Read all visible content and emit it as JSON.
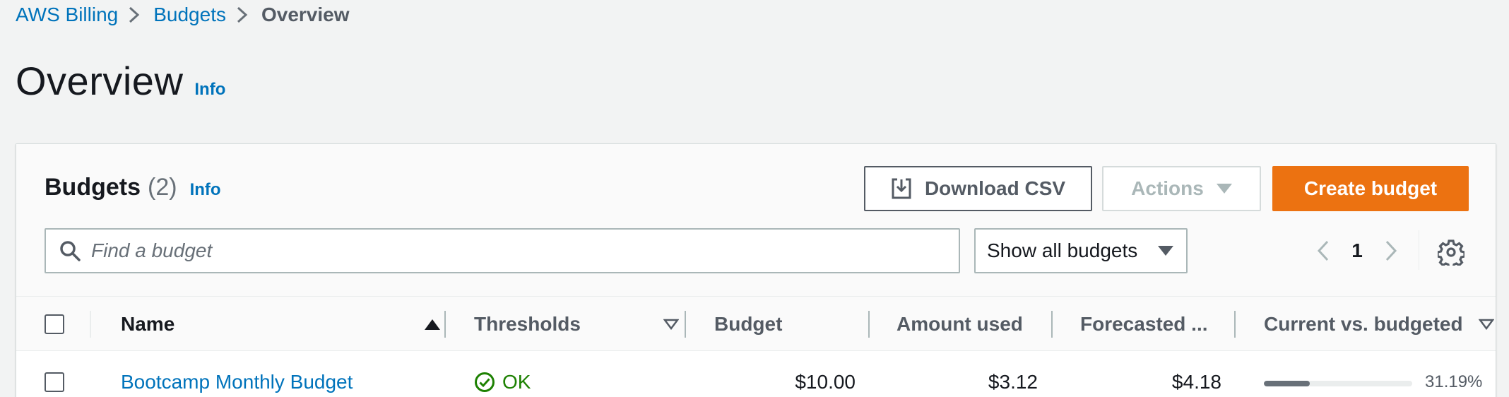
{
  "breadcrumb": {
    "items": [
      {
        "label": "AWS Billing"
      },
      {
        "label": "Budgets"
      },
      {
        "label": "Overview"
      }
    ]
  },
  "page": {
    "title": "Overview",
    "info": "Info"
  },
  "budgets_panel": {
    "title": "Budgets",
    "count": "(2)",
    "info": "Info",
    "download_label": "Download CSV",
    "actions_label": "Actions",
    "create_label": "Create budget",
    "search_placeholder": "Find a budget",
    "filter_value": "Show all budgets",
    "current_page": "1"
  },
  "table": {
    "columns": {
      "name": "Name",
      "thresholds": "Thresholds",
      "budget": "Budget",
      "amount_used": "Amount used",
      "forecasted": "Forecasted ...",
      "current_vs_budgeted": "Current vs. budgeted"
    },
    "rows": [
      {
        "name": "Bootcamp Monthly Budget",
        "threshold_status": "OK",
        "budget": "$10.00",
        "amount_used": "$3.12",
        "forecasted": "$4.18",
        "current_vs_budgeted": "31.19%",
        "progress_fraction": 0.3119
      }
    ]
  },
  "colors": {
    "link": "#0073bb",
    "primary": "#ec7211",
    "success": "#1d8102",
    "page_bg": "#f2f3f3"
  },
  "icons": [
    "chevron-right-icon",
    "download-icon",
    "caret-down-icon",
    "search-icon",
    "chevron-left-icon",
    "settings-gear-icon",
    "sort-ascending-icon",
    "sort-descending-icon",
    "status-ok-icon"
  ]
}
